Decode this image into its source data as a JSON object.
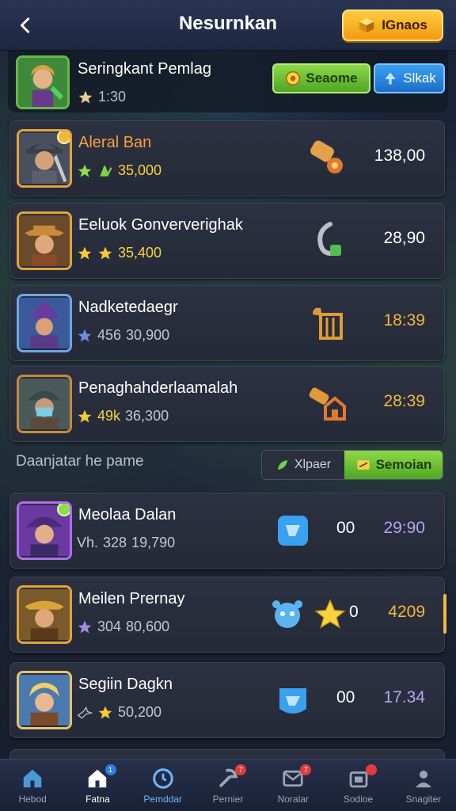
{
  "header": {
    "title": "Nesurnkan",
    "gold_button_label": "IGnaos"
  },
  "top_row": {
    "name": "Seringkant Pemlag",
    "rating": "1:30",
    "green_button": "Seaome",
    "blue_button": "Slkak"
  },
  "cards": [
    {
      "name": "Aleral Ban",
      "rating_a": "",
      "rating_b": "35,000",
      "value": "138,00"
    },
    {
      "name": "Eeluok Gonververighak",
      "rating_b": "35,400",
      "value": "28,90"
    },
    {
      "name": "Nadketedaegr",
      "rating_a": "456",
      "rating_b": "30,900",
      "value": "18:39"
    },
    {
      "name": "Penaghahderlaamalah",
      "rating_a": "49k",
      "rating_b": "36,300",
      "value": "28:39"
    }
  ],
  "section": {
    "title": "Daanjatar he pame",
    "seg_left": "Xlpaer",
    "seg_right": "Semoian"
  },
  "cards2": [
    {
      "name": "Meolaa Dalan",
      "rating_pre": "Vh.",
      "rating_a": "328",
      "rating_b": "19,790",
      "qty": "00",
      "value": "29:90"
    },
    {
      "name": "Meilen Prernay",
      "rating_a": "304",
      "rating_b": "80,600",
      "qty": "0",
      "value": "4209"
    },
    {
      "name": "Segiin Dagkn",
      "rating_b": "50,200",
      "qty": "00",
      "value": "17.34"
    }
  ],
  "nav": [
    {
      "label": "Hebod",
      "icon": "home-icon"
    },
    {
      "label": "Fatna",
      "icon": "house-icon",
      "badge": "1"
    },
    {
      "label": "Pemddar",
      "icon": "clock-icon"
    },
    {
      "label": "Pernier",
      "icon": "tools-icon",
      "badge": "7"
    },
    {
      "label": "Noralar",
      "icon": "mail-icon",
      "badge": "7"
    },
    {
      "label": "Sodioe",
      "icon": "store-icon",
      "badge": ""
    },
    {
      "label": "Snagiter",
      "icon": "profile-icon"
    }
  ]
}
